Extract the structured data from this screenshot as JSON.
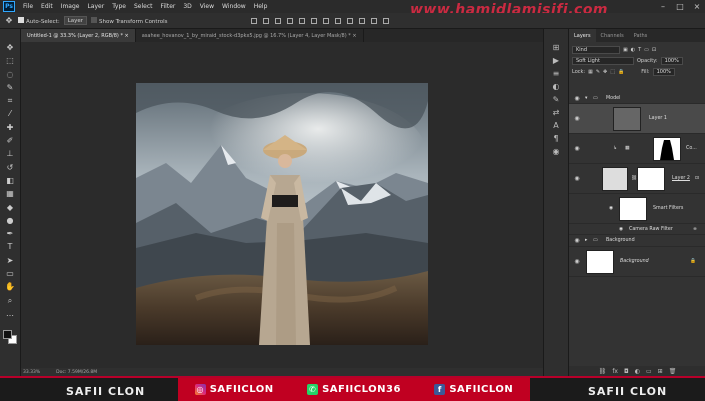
{
  "menubar": {
    "logo": "Ps",
    "items": [
      "File",
      "Edit",
      "Image",
      "Layer",
      "Type",
      "Select",
      "Filter",
      "3D",
      "View",
      "Window",
      "Help"
    ],
    "watermark": "www.hamidlamisifi.com"
  },
  "options": {
    "auto_select_label": "Auto-Select:",
    "auto_select_value": "Layer",
    "transform_label": "Show Transform Controls"
  },
  "tabs": [
    {
      "label": "Untitled-1 @ 33.3% (Layer 2, RGB/8) *  ×"
    },
    {
      "label": "asahee_hovanov_1_by_miraid_stock-d3pkx5.jpg @ 16.7% (Layer 4, Layer Mask/8) *  ×"
    }
  ],
  "status": {
    "zoom": "33.33%",
    "doc": "Doc: 7.59M/26.8M"
  },
  "layers_panel": {
    "tabs": [
      "Layers",
      "Channels",
      "Paths"
    ],
    "kind": "Kind",
    "blend_mode": "Soft Light",
    "opacity_label": "Opacity:",
    "opacity_value": "100%",
    "lock_label": "Lock:",
    "fill_label": "Fill:",
    "fill_value": "100%",
    "layers": [
      {
        "name": "Model",
        "type": "group"
      },
      {
        "name": "Layer 1",
        "type": "layer"
      },
      {
        "name": "Co...",
        "type": "adjustment"
      },
      {
        "name": "Layer 2",
        "type": "smart"
      },
      {
        "name": "Smart Filters",
        "type": "filter"
      },
      {
        "name": "Camera Raw Filter",
        "type": "filter-item"
      },
      {
        "name": "Background",
        "type": "group"
      },
      {
        "name": "Background",
        "type": "background"
      }
    ]
  },
  "banner": {
    "left": "SAFII CLON",
    "instagram": "SAFIICLON",
    "whatsapp": "SAFIICLON36",
    "facebook": "SAFIICLON",
    "right": "SAFII CLON"
  }
}
